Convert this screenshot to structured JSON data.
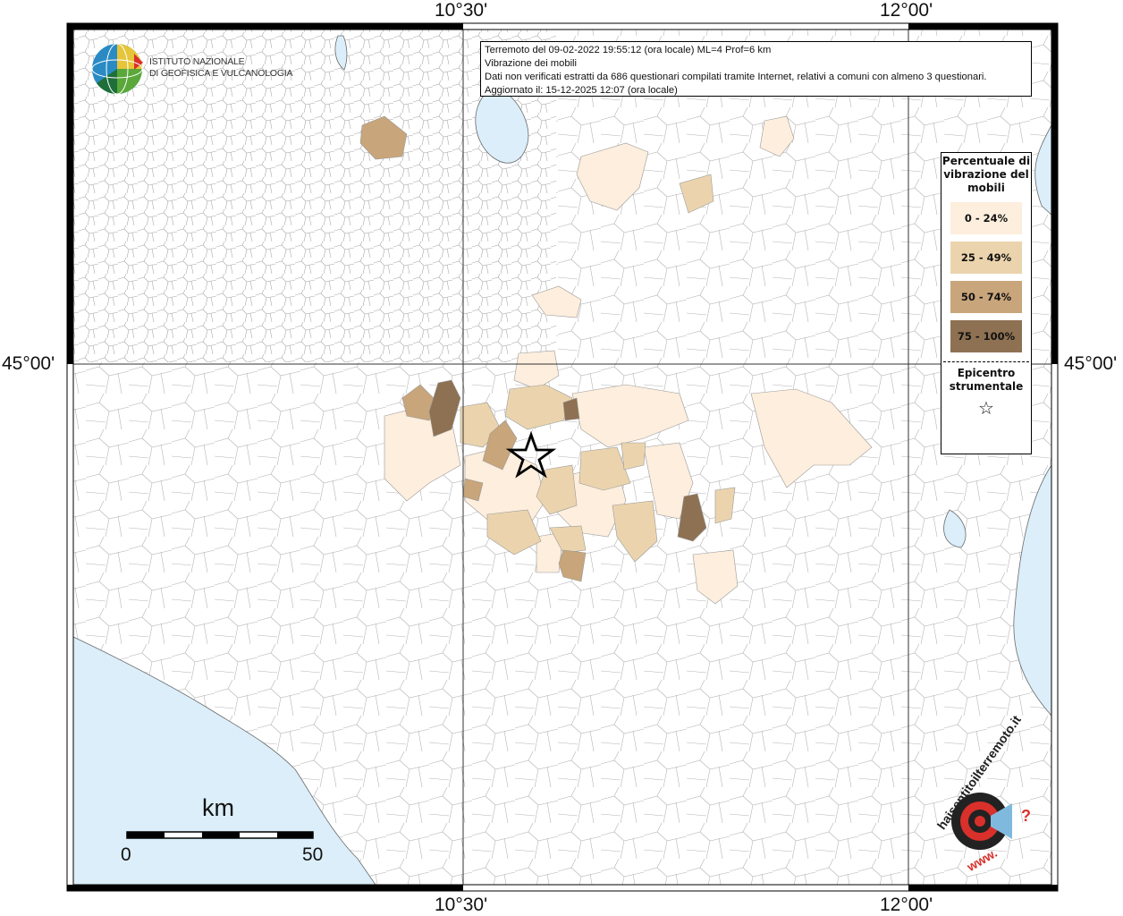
{
  "coordinates": {
    "top_left_lon": "10°30'",
    "top_right_lon": "12°00'",
    "bottom_left_lon": "10°30'",
    "bottom_right_lon": "12°00'",
    "left_lat": "45°00'",
    "right_lat": "45°00'"
  },
  "logo": {
    "line1": "ISTITUTO NAZIONALE",
    "line2": "DI GEOFISICA E VULCANOLOGIA"
  },
  "info": {
    "line1": "Terremoto del 09-02-2022 19:55:12 (ora locale) ML=4 Prof=6 km",
    "line2": "Vibrazione dei mobili",
    "line3": "Dati non verificati estratti da 686 questionari compilati tramite Internet, relativi a comuni con almeno 3 questionari.",
    "line4": "Aggiornato il: 15-12-2025 12:07 (ora locale)"
  },
  "legend": {
    "title": "Percentuale di vibrazione del mobili",
    "items": [
      {
        "label": "0 - 24%",
        "color": "#fdeedd"
      },
      {
        "label": "25 - 49%",
        "color": "#ebd4ad"
      },
      {
        "label": "50 - 74%",
        "color": "#c8a57a"
      },
      {
        "label": "75 - 100%",
        "color": "#8e7152"
      }
    ],
    "epicenter_title": "Epicentro strumentale",
    "epicenter_symbol": "☆"
  },
  "scale": {
    "unit": "km",
    "min": "0",
    "max": "50"
  },
  "watermark": {
    "text": "haisentitoilterremoto.it",
    "prefix": "www.",
    "suffix": "?"
  },
  "colors": {
    "sea": "#dbeef9",
    "land": "#ffffff",
    "border": "#9a9a9a"
  }
}
